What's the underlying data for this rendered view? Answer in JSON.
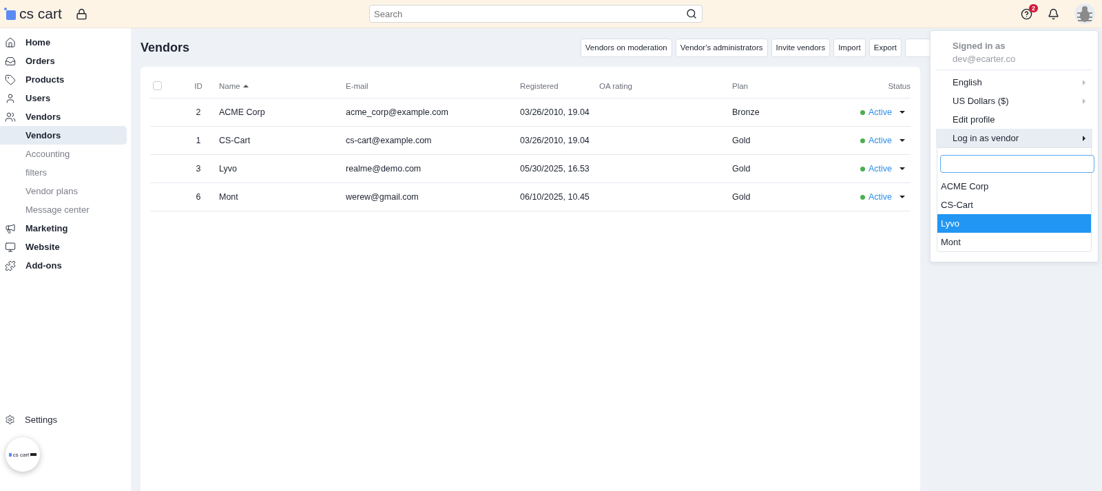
{
  "header": {
    "logo": "cs cart",
    "search": {
      "placeholder": "Search"
    },
    "help_badge": "2"
  },
  "sidebar": {
    "items": [
      {
        "label": "Home",
        "selected": false
      },
      {
        "label": "Orders",
        "selected": false
      },
      {
        "label": "Products",
        "selected": false
      },
      {
        "label": "Users",
        "selected": false
      },
      {
        "label": "Vendors",
        "selected": false,
        "children": [
          {
            "label": "Vendors",
            "selected": true
          },
          {
            "label": "Accounting",
            "selected": false
          },
          {
            "label": "filters",
            "selected": false
          },
          {
            "label": "Vendor plans",
            "selected": false
          },
          {
            "label": "Message center",
            "selected": false
          }
        ]
      },
      {
        "label": "Marketing",
        "selected": false
      },
      {
        "label": "Website",
        "selected": false
      },
      {
        "label": "Add-ons",
        "selected": false
      }
    ],
    "settings": "Settings",
    "badge_logo": "cs cart"
  },
  "page": {
    "title": "Vendors",
    "buttons": [
      "Vendors on moderation",
      "Vendor's administrators",
      "Invite vendors",
      "Import",
      "Export"
    ]
  },
  "table": {
    "columns": [
      {
        "label": "ID",
        "sorted": false
      },
      {
        "label": "Name",
        "sorted": true
      },
      {
        "label": "E-mail",
        "sorted": false
      },
      {
        "label": "Registered",
        "sorted": false
      },
      {
        "label": "OA rating",
        "sorted": false
      },
      {
        "label": "Plan",
        "sorted": false
      },
      {
        "label": "Status",
        "sorted": false
      }
    ],
    "all_checked": false,
    "rows": [
      {
        "id": "2",
        "name": "ACME Corp",
        "email": "acme_corp@example.com",
        "registered": "03/26/2010, 19.04",
        "plan": "Bronze",
        "status": "Active",
        "color": "#4caf50"
      },
      {
        "id": "1",
        "name": "CS-Cart",
        "email": "cs-cart@example.com",
        "registered": "03/26/2010, 19.04",
        "plan": "Gold",
        "status": "Active",
        "color": "#4caf50"
      },
      {
        "id": "3",
        "name": "Lyvo",
        "email": "realme@demo.com",
        "registered": "05/30/2025, 16.53",
        "plan": "Gold",
        "status": "Active",
        "color": "#4caf50"
      },
      {
        "id": "6",
        "name": "Mont",
        "email": "werew@gmail.com",
        "registered": "06/10/2025, 10.45",
        "plan": "Gold",
        "status": "Active",
        "color": "#4caf50"
      }
    ]
  },
  "account_menu": {
    "signed_in_label": "Signed in as",
    "email": "dev@ecarter.co",
    "items": [
      {
        "label": "English",
        "kind": "submenu",
        "selected": false
      },
      {
        "label": "US Dollars  ($)",
        "kind": "submenu",
        "selected": false
      },
      {
        "label": "Edit profile",
        "kind": "plain",
        "selected": false
      },
      {
        "label": "Log in as vendor",
        "kind": "submenu",
        "selected": true
      }
    ],
    "vendor_list": [
      {
        "label": "ACME Corp",
        "selected": false
      },
      {
        "label": "CS-Cart",
        "selected": false
      },
      {
        "label": "Lyvo",
        "selected": true
      },
      {
        "label": "Mont",
        "selected": false
      }
    ]
  }
}
